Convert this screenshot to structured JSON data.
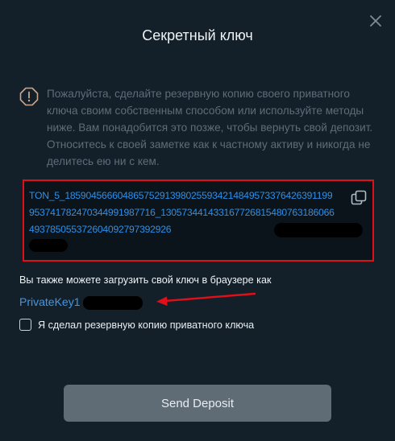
{
  "dialog": {
    "title": "Секретный ключ",
    "notice": "Пожалуйста, сделайте резервную копию своего приватного ключа своим собственным способом или используйте методы ниже. Вам понадобится это позже, чтобы вернуть свой депозит. Относитесь к своей заметке как к частному активу и никогда не делитесь ею ни с кем.",
    "private_key": "TON_5_185904566604865752913980255934214849573376426391199953741782470344991987716_130573441433167726815480763186066493785055372604092797392926",
    "download_text": "Вы также можете загрузить свой ключ в браузере как",
    "file_name": "PrivateKey1                  .txt",
    "checkbox_label": "Я сделал резервную копию приватного ключа",
    "checkbox_checked": false,
    "send_button": "Send Deposit"
  },
  "icons": {
    "close": "close-icon",
    "warning": "warning-icon",
    "copy": "copy-icon"
  },
  "colors": {
    "background": "#142029",
    "link": "#3d97ec",
    "highlight_border": "#e0101a",
    "button": "#5f6c76"
  }
}
